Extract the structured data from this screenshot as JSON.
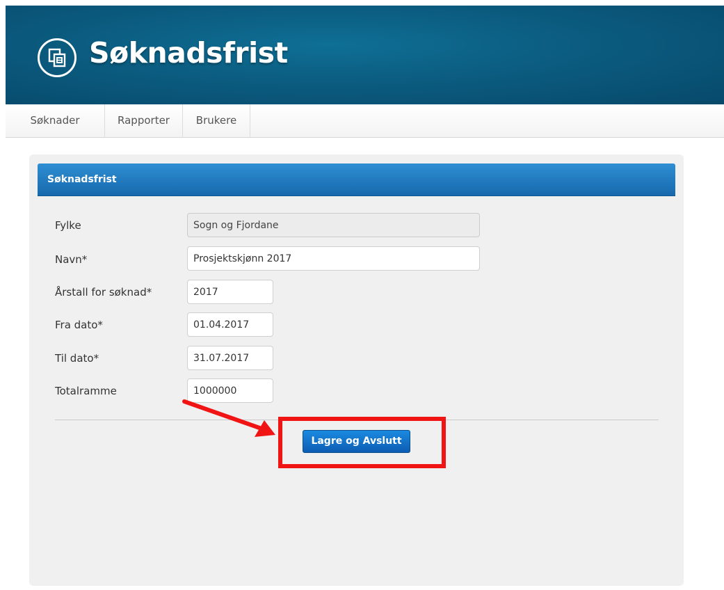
{
  "header": {
    "brand_title": "Søknadsfrist",
    "logo_icon": "document-stack-icon"
  },
  "nav": {
    "items": [
      {
        "label": "Søknader"
      },
      {
        "label": "Rapporter"
      },
      {
        "label": "Brukere"
      }
    ]
  },
  "panel": {
    "title": "Søknadsfrist"
  },
  "form": {
    "fields": [
      {
        "label": "Fylke",
        "value": "Sogn og Fjordane",
        "disabled": true
      },
      {
        "label": "Navn*",
        "value": "Prosjektskjønn 2017",
        "disabled": false
      },
      {
        "label": "Årstall for søknad*",
        "value": "2017",
        "disabled": false
      },
      {
        "label": "Fra dato*",
        "value": "01.04.2017",
        "disabled": false
      },
      {
        "label": "Til dato*",
        "value": "31.07.2017",
        "disabled": false
      },
      {
        "label": "Totalramme",
        "value": "1000000",
        "disabled": false
      }
    ],
    "save_label": "Lagre og Avslutt"
  },
  "colors": {
    "header_bg": "#0b5c80",
    "panel_header_bg": "#1f7cc4",
    "button_bg": "#1173cc",
    "annotation": "#f01414"
  }
}
